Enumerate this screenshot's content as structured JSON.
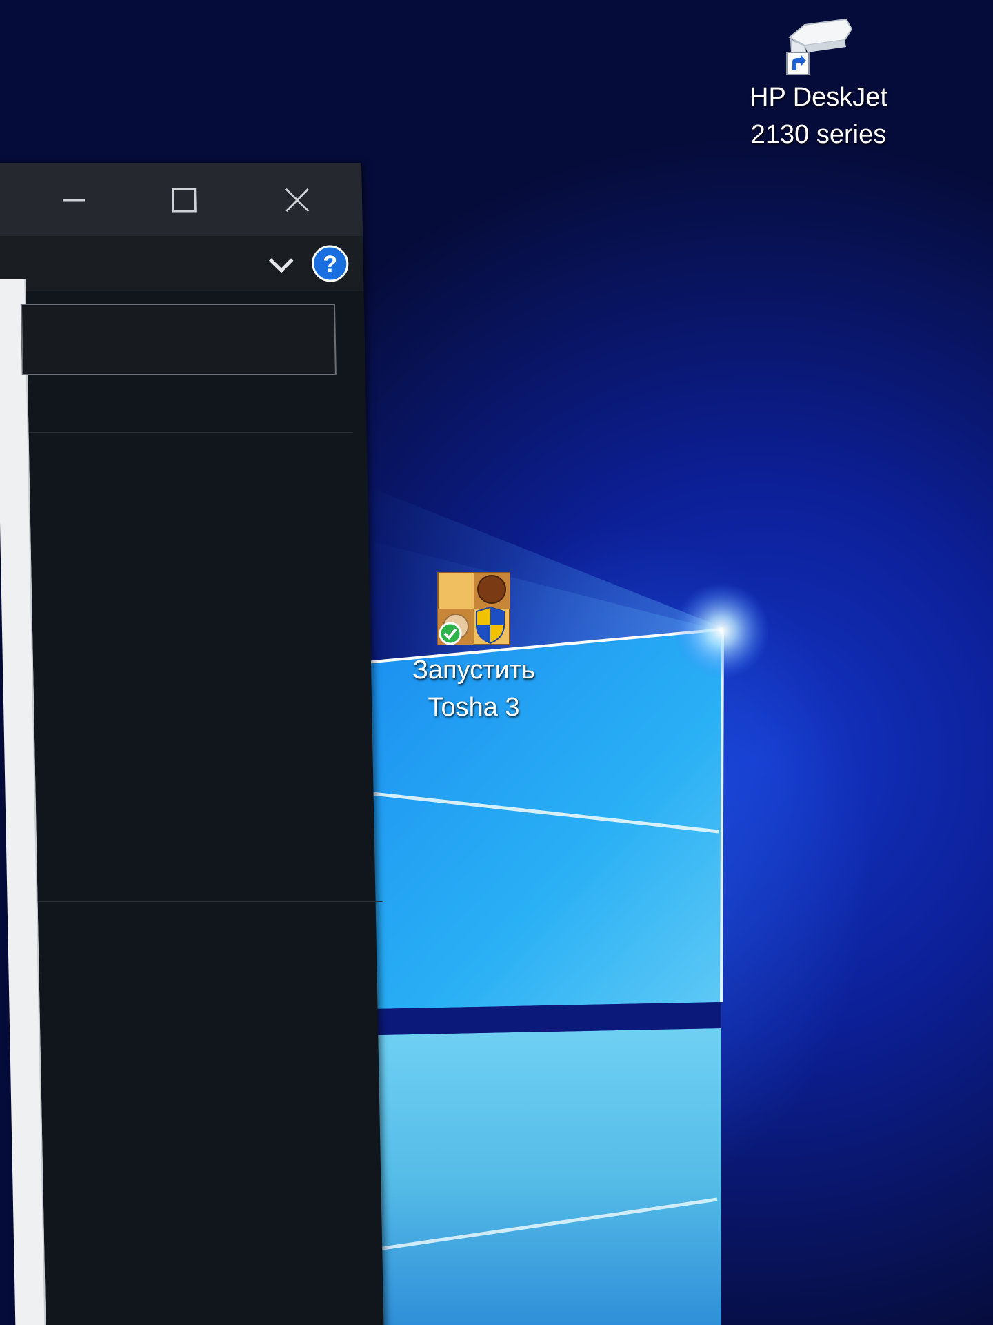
{
  "desktop": {
    "icons": [
      {
        "label": "HP DeskJet\n2130 series",
        "icon": "printer-shortcut-icon"
      },
      {
        "label": "Запустить\nTosha 3",
        "icon": "checkers-game-icon"
      }
    ]
  },
  "window": {
    "controls": {
      "minimize_icon": "minimize-icon",
      "maximize_icon": "maximize-icon",
      "close_icon": "close-icon"
    },
    "ribbon": {
      "expand_icon": "chevron-down-icon",
      "help_icon": "help-icon",
      "help_glyph": "?"
    },
    "address_bar": {
      "value": ""
    }
  },
  "colors": {
    "titlebar": "#25292f",
    "window_bg": "#11151c",
    "help_blue": "#1a6fe0",
    "desktop_blue": "#0c1f96"
  }
}
